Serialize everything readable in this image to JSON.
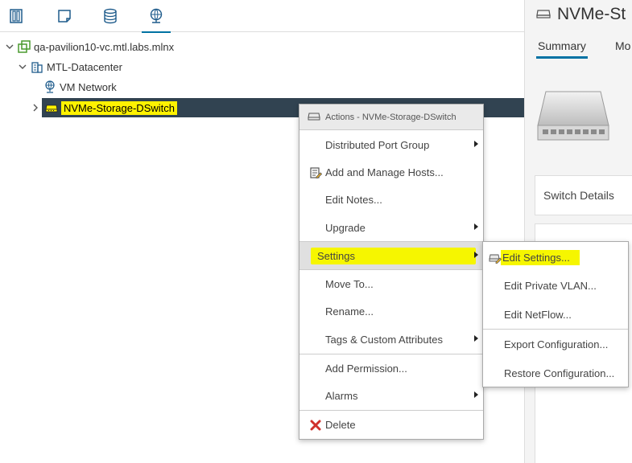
{
  "inventory_tabs": [
    {
      "name": "hosts-clusters",
      "icon": "hosts-clusters-icon"
    },
    {
      "name": "vms-templates",
      "icon": "vms-templates-icon"
    },
    {
      "name": "storage",
      "icon": "storage-icon"
    },
    {
      "name": "networking",
      "icon": "networking-icon",
      "active": true
    }
  ],
  "tree": {
    "vcenter": "qa-pavilion10-vc.mtl.labs.mlnx",
    "datacenter": "MTL-Datacenter",
    "network": "VM Network",
    "dswitch": "NVMe-Storage-DSwitch"
  },
  "context_menu": {
    "header": "Actions - NVMe-Storage-DSwitch",
    "items": [
      {
        "label": "Distributed Port Group",
        "submenu": true
      },
      {
        "label": "Add and Manage Hosts...",
        "icon": "add-hosts-icon"
      },
      {
        "label": "Edit Notes..."
      },
      {
        "label": "Upgrade",
        "submenu": true
      },
      {
        "label": "Settings",
        "submenu": true,
        "highlighted": true
      },
      {
        "label": "Move To..."
      },
      {
        "label": "Rename..."
      },
      {
        "label": "Tags & Custom Attributes",
        "submenu": true
      },
      {
        "label": "Add Permission..."
      },
      {
        "label": "Alarms",
        "submenu": true
      },
      {
        "label": "Delete",
        "icon": "delete-icon"
      }
    ]
  },
  "settings_submenu": {
    "items": [
      {
        "label": "Edit Settings...",
        "icon": "edit-settings-icon",
        "highlighted": true
      },
      {
        "label": "Edit Private VLAN..."
      },
      {
        "label": "Edit NetFlow..."
      },
      {
        "label": "Export Configuration..."
      },
      {
        "label": "Restore Configuration..."
      }
    ]
  },
  "right_panel": {
    "title": "NVMe-St",
    "tabs": [
      "Summary",
      "Mo"
    ],
    "active_tab": "Summary",
    "switch_details": "Switch Details"
  },
  "colors": {
    "highlight": "#f6f600",
    "selected_row": "#314351",
    "accent": "#0072a3"
  }
}
